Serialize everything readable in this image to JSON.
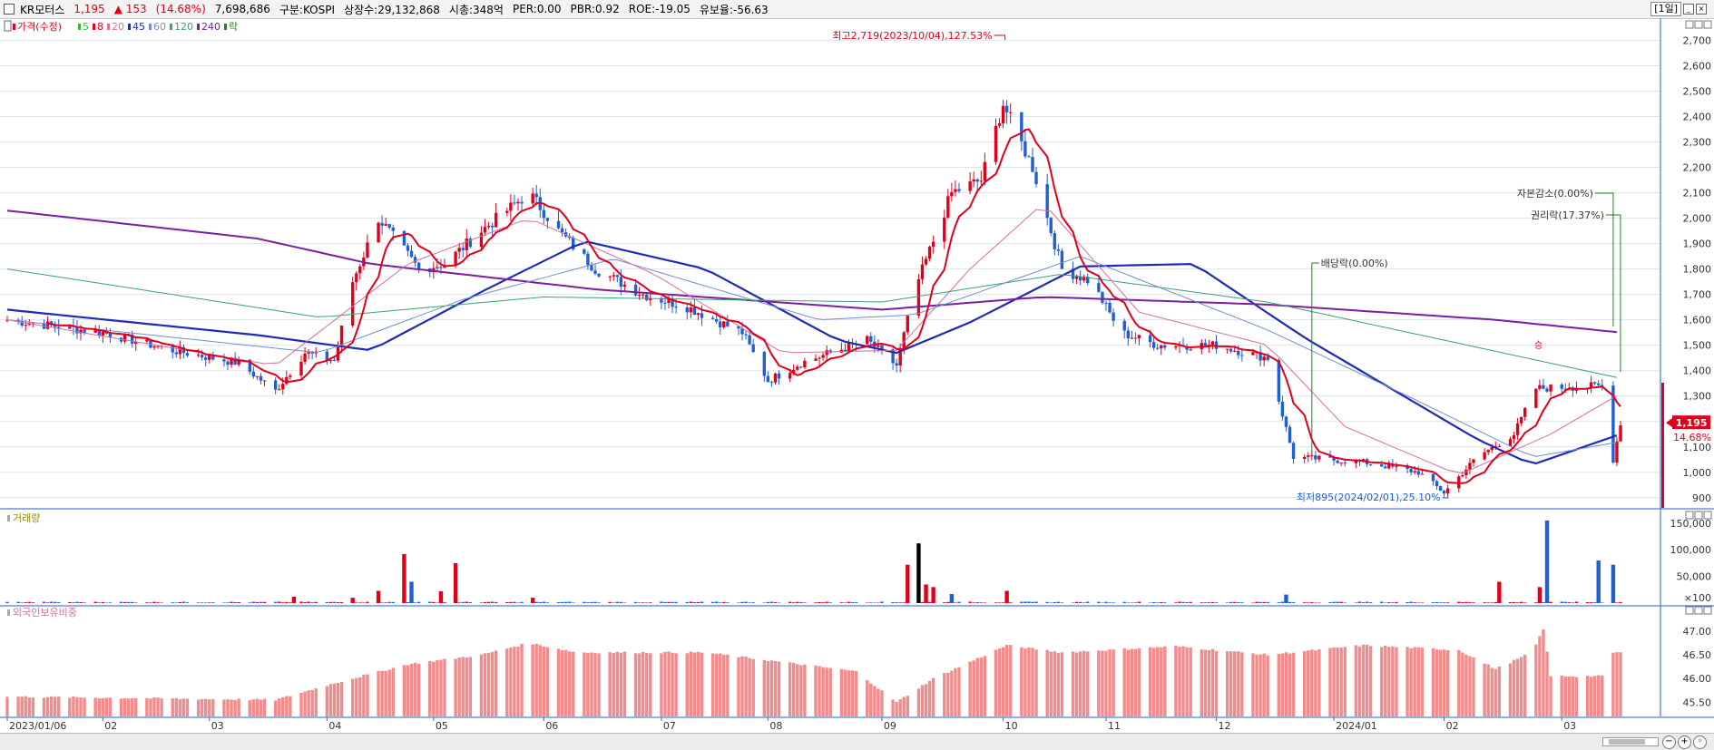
{
  "header": {
    "stock_name": "KR모터스",
    "price": "1,195",
    "change": "▲ 153",
    "change_pct": "(14.68%)",
    "volume": "7,698,686",
    "market": "구분:KOSPI",
    "shares": "상장수:29,132,868",
    "market_cap": "시총:348억",
    "per": "PER:0.00",
    "pbr": "PBR:0.92",
    "roe": "ROE:-19.05",
    "retention": "유보율:-56.63",
    "period": "[1일]"
  },
  "legend": {
    "price_label": "가격(수정)",
    "ma": [
      {
        "label": "5",
        "color": "#3ab53a"
      },
      {
        "label": "8",
        "color": "#e0001b"
      },
      {
        "label": "20",
        "color": "#d36f9e"
      },
      {
        "label": "45",
        "color": "#1f2bb4"
      },
      {
        "label": "60",
        "color": "#6f8fce"
      },
      {
        "label": "120",
        "color": "#3aa276"
      },
      {
        "label": "240",
        "color": "#7a1fa3"
      },
      {
        "label": "락",
        "color": "#178a17"
      }
    ],
    "volume_label": "거래량",
    "foreign_label": "외국인보유비중"
  },
  "annotations": {
    "high": "최고2,719(2023/10/04),127.53%",
    "low": "최저895(2024/02/01),25.10%",
    "dividend": "배당락(0.00%)",
    "capital_reduction": "자본감소(0.00%)",
    "rights": "권리락(17.37%)",
    "price_tag": "1,195",
    "pct_tag": "14.68%",
    "small_mark": "승"
  },
  "colors": {
    "up": "#e0001b",
    "down": "#1f5fd0",
    "foreign_bar": "#f28b8b",
    "grid": "#dfe3ea"
  },
  "chart_data": {
    "type": "candlestick",
    "x_tick_labels": [
      "2023/01/06",
      "02",
      "03",
      "04",
      "05",
      "06",
      "07",
      "08",
      "09",
      "10",
      "11",
      "12",
      "2024/01",
      "02",
      "03"
    ],
    "price_axis": {
      "ylim": [
        860,
        2780
      ],
      "ticks": [
        "900",
        "1,000",
        "1,100",
        "1,200",
        "1,300",
        "1,400",
        "1,500",
        "1,600",
        "1,700",
        "1,800",
        "1,900",
        "2,000",
        "2,100",
        "2,200",
        "2,300",
        "2,400",
        "2,500",
        "2,600",
        "2,700"
      ]
    },
    "volume_axis": {
      "ylim": [
        0,
        165000
      ],
      "ticks": [
        "×100",
        "50,000",
        "100,000",
        "150,000"
      ]
    },
    "foreign_axis": {
      "ylim": [
        45.2,
        47.4
      ],
      "ticks": [
        "45.50",
        "46.00",
        "46.50",
        "47.00"
      ]
    },
    "close_anchors": [
      [
        "2023/01/06",
        1600
      ],
      [
        "2023/02/01",
        1550
      ],
      [
        "2023/02/20",
        1480
      ],
      [
        "2023/03/10",
        1430
      ],
      [
        "2023/03/20",
        1320
      ],
      [
        "2023/03/28",
        1470
      ],
      [
        "2023/04/05",
        1440
      ],
      [
        "2023/04/10",
        1750
      ],
      [
        "2023/04/17",
        2000
      ],
      [
        "2023/04/28",
        1800
      ],
      [
        "2023/05/05",
        1820
      ],
      [
        "2023/05/15",
        1950
      ],
      [
        "2023/05/28",
        2100
      ],
      [
        "2023/06/05",
        1950
      ],
      [
        "2023/06/15",
        1800
      ],
      [
        "2023/06/28",
        1700
      ],
      [
        "2023/07/10",
        1650
      ],
      [
        "2023/07/25",
        1550
      ],
      [
        "2023/08/01",
        1360
      ],
      [
        "2023/08/10",
        1430
      ],
      [
        "2023/08/20",
        1480
      ],
      [
        "2023/08/28",
        1520
      ],
      [
        "2023/09/05",
        1420
      ],
      [
        "2023/09/10",
        1720
      ],
      [
        "2023/09/20",
        2100
      ],
      [
        "2023/09/28",
        2150
      ],
      [
        "2023/10/04",
        2450
      ],
      [
        "2023/10/12",
        2200
      ],
      [
        "2023/10/20",
        1800
      ],
      [
        "2023/10/28",
        1750
      ],
      [
        "2023/11/05",
        1550
      ],
      [
        "2023/11/15",
        1500
      ],
      [
        "2023/12/01",
        1500
      ],
      [
        "2023/12/15",
        1450
      ],
      [
        "2023/12/22",
        1060
      ],
      [
        "2024/01/10",
        1040
      ],
      [
        "2024/01/25",
        1000
      ],
      [
        "2024/02/01",
        920
      ],
      [
        "2024/02/10",
        1060
      ],
      [
        "2024/02/20",
        1150
      ],
      [
        "2024/02/26",
        1330
      ],
      [
        "2024/03/15",
        1340
      ],
      [
        "2024/03/18",
        1050
      ],
      [
        "2024/03/20",
        1195
      ]
    ],
    "ma_anchors": {
      "ma45": [
        [
          "2023/01/06",
          1640
        ],
        [
          "2023/03/15",
          1540
        ],
        [
          "2023/04/15",
          1480
        ],
        [
          "2023/05/15",
          1710
        ],
        [
          "2023/06/12",
          1910
        ],
        [
          "2023/07/15",
          1800
        ],
        [
          "2023/08/20",
          1520
        ],
        [
          "2023/09/05",
          1470
        ],
        [
          "2023/09/25",
          1590
        ],
        [
          "2023/10/25",
          1810
        ],
        [
          "2023/11/25",
          1820
        ],
        [
          "2023/12/25",
          1530
        ],
        [
          "2024/02/10",
          1130
        ],
        [
          "2024/02/25",
          1030
        ],
        [
          "2024/03/20",
          1150
        ]
      ],
      "ma240": [
        [
          "2023/01/06",
          2030
        ],
        [
          "2023/03/15",
          1920
        ],
        [
          "2023/04/15",
          1820
        ],
        [
          "2023/06/15",
          1720
        ],
        [
          "2023/09/01",
          1640
        ],
        [
          "2023/10/15",
          1690
        ],
        [
          "2023/12/15",
          1660
        ],
        [
          "2024/02/15",
          1600
        ],
        [
          "2024/03/20",
          1550
        ]
      ],
      "ma120": [
        [
          "2023/01/06",
          1800
        ],
        [
          "2023/04/01",
          1610
        ],
        [
          "2023/06/01",
          1690
        ],
        [
          "2023/09/01",
          1670
        ],
        [
          "2023/10/20",
          1780
        ],
        [
          "2023/12/15",
          1670
        ],
        [
          "2024/02/01",
          1520
        ],
        [
          "2024/03/20",
          1370
        ]
      ],
      "ma60": [
        [
          "2023/01/06",
          1600
        ],
        [
          "2023/04/01",
          1470
        ],
        [
          "2023/05/10",
          1680
        ],
        [
          "2023/06/20",
          1840
        ],
        [
          "2023/08/15",
          1600
        ],
        [
          "2023/09/10",
          1620
        ],
        [
          "2023/10/25",
          1850
        ],
        [
          "2023/12/15",
          1560
        ],
        [
          "2024/01/25",
          1280
        ],
        [
          "2024/02/25",
          1060
        ],
        [
          "2024/03/20",
          1120
        ]
      ],
      "ma20": [
        [
          "2023/01/06",
          1600
        ],
        [
          "2023/03/20",
          1420
        ],
        [
          "2023/04/25",
          1820
        ],
        [
          "2023/05/28",
          2000
        ],
        [
          "2023/07/01",
          1780
        ],
        [
          "2023/08/05",
          1470
        ],
        [
          "2023/09/05",
          1480
        ],
        [
          "2023/09/25",
          1800
        ],
        [
          "2023/10/15",
          2060
        ],
        [
          "2023/11/10",
          1630
        ],
        [
          "2023/12/15",
          1500
        ],
        [
          "2024/01/05",
          1180
        ],
        [
          "2024/02/05",
          990
        ],
        [
          "2024/03/01",
          1150
        ],
        [
          "2024/03/20",
          1310
        ]
      ]
    },
    "volume_spikes": [
      [
        "2023/03/25",
        12000,
        "up"
      ],
      [
        "2023/04/10",
        10000,
        "up"
      ],
      [
        "2023/04/17",
        23000,
        "up"
      ],
      [
        "2023/04/24",
        92000,
        "up"
      ],
      [
        "2023/04/26",
        40000,
        "down"
      ],
      [
        "2023/05/04",
        22000,
        "up"
      ],
      [
        "2023/05/08",
        75000,
        "up"
      ],
      [
        "2023/05/29",
        10000,
        "up"
      ],
      [
        "2023/09/08",
        72000,
        "up"
      ],
      [
        "2023/09/11",
        112000,
        "black"
      ],
      [
        "2023/09/13",
        35000,
        "up"
      ],
      [
        "2023/09/15",
        30000,
        "up"
      ],
      [
        "2023/09/20",
        17000,
        "down"
      ],
      [
        "2023/10/05",
        23000,
        "up"
      ],
      [
        "2023/12/20",
        16000,
        "down"
      ],
      [
        "2024/02/16",
        40000,
        "up"
      ],
      [
        "2024/02/27",
        30000,
        "up"
      ],
      [
        "2024/02/29",
        155000,
        "down"
      ],
      [
        "2024/03/14",
        80000,
        "down"
      ],
      [
        "2024/03/18",
        72000,
        "down"
      ]
    ],
    "foreign_anchors": [
      [
        "2023/01/06",
        45.62
      ],
      [
        "2023/03/20",
        45.55
      ],
      [
        "2023/04/05",
        45.9
      ],
      [
        "2023/04/25",
        46.3
      ],
      [
        "2023/05/15",
        46.5
      ],
      [
        "2023/05/28",
        46.75
      ],
      [
        "2023/06/10",
        46.55
      ],
      [
        "2023/07/15",
        46.55
      ],
      [
        "2023/08/25",
        46.15
      ],
      [
        "2023/09/05",
        45.5
      ],
      [
        "2023/09/15",
        46.0
      ],
      [
        "2023/09/25",
        46.35
      ],
      [
        "2023/10/05",
        46.7
      ],
      [
        "2023/10/20",
        46.55
      ],
      [
        "2023/11/20",
        46.68
      ],
      [
        "2023/12/15",
        46.5
      ],
      [
        "2024/01/10",
        46.7
      ],
      [
        "2024/02/05",
        46.6
      ],
      [
        "2024/02/15",
        46.2
      ],
      [
        "2024/02/25",
        46.55
      ],
      [
        "2024/02/28",
        47.05
      ],
      [
        "2024/03/01",
        46.05
      ],
      [
        "2024/03/15",
        46.05
      ],
      [
        "2024/03/18",
        46.55
      ],
      [
        "2024/03/20",
        46.55
      ]
    ]
  }
}
